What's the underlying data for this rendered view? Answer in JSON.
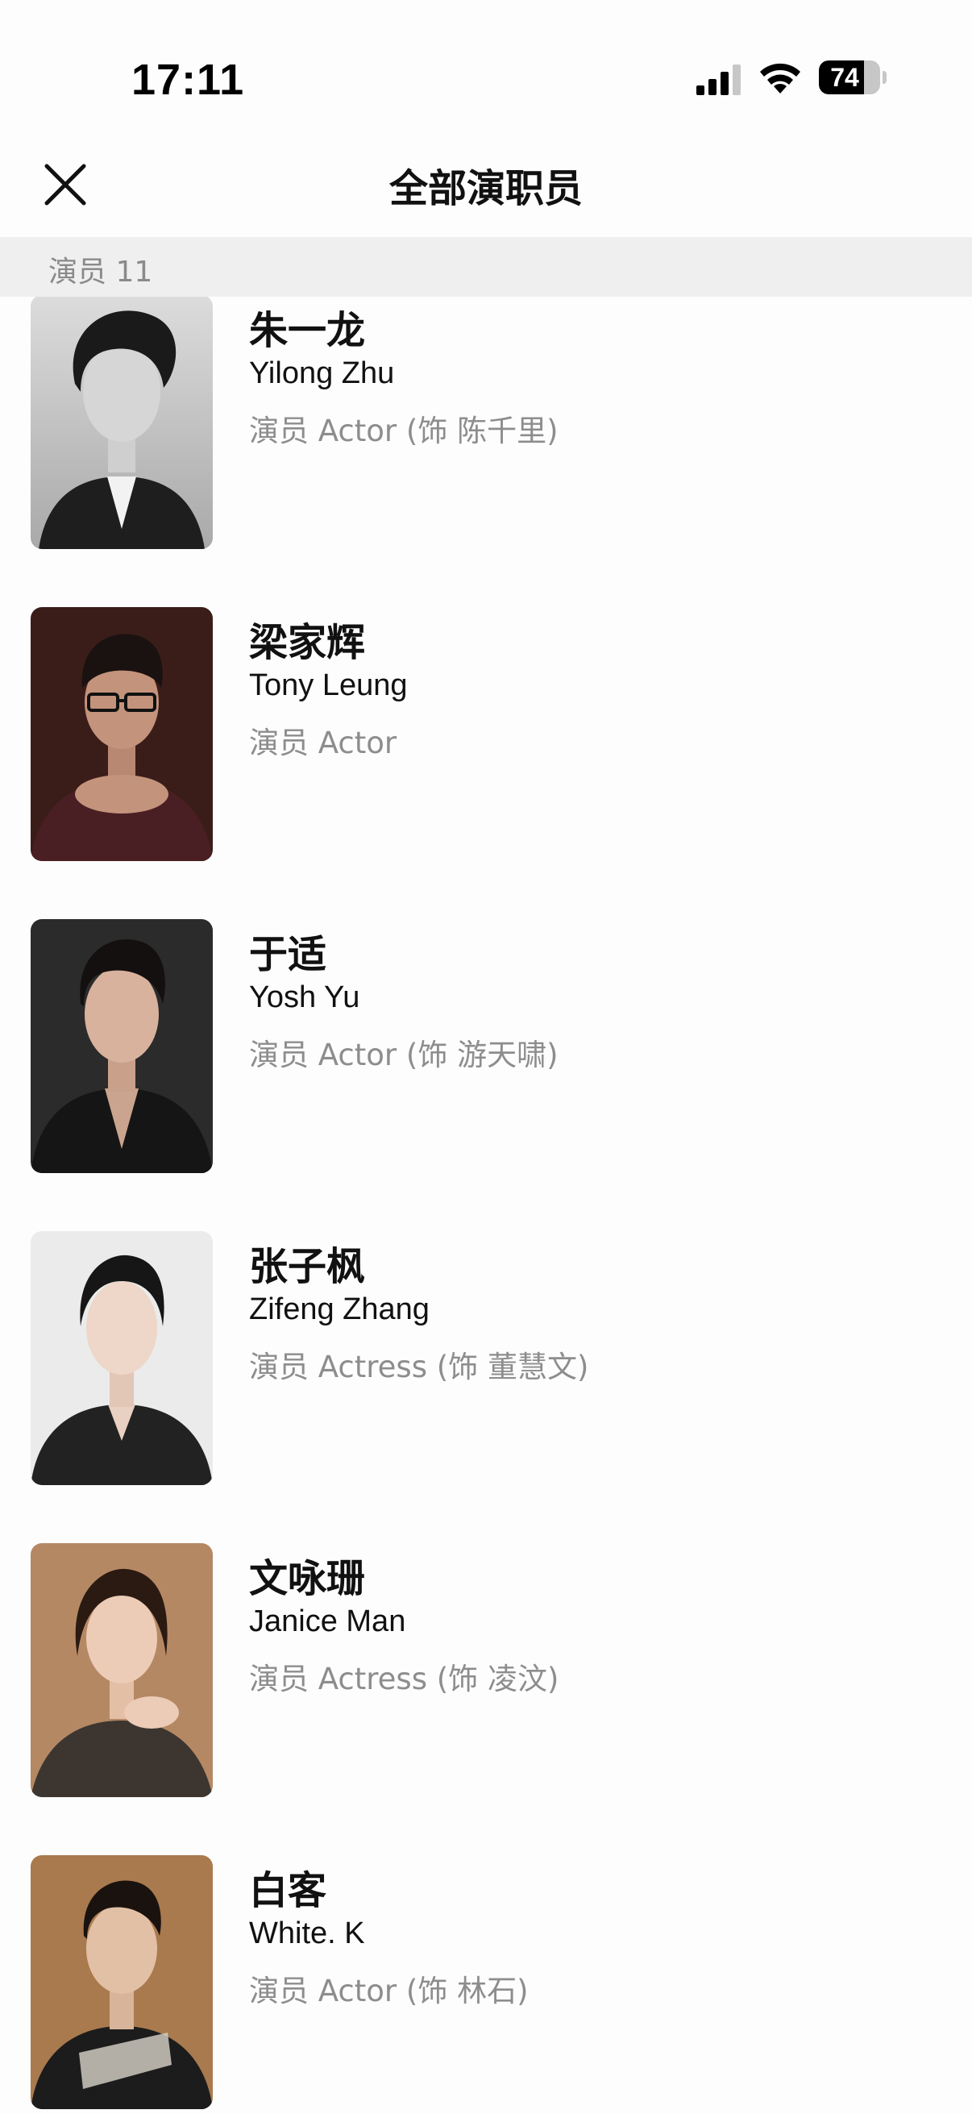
{
  "status_bar": {
    "time": "17:11",
    "battery": 74,
    "battery_label": "74",
    "icons": [
      "signal-icon",
      "wifi-icon",
      "battery-icon"
    ]
  },
  "header": {
    "title": "全部演职员",
    "close_icon": "close-icon"
  },
  "section": {
    "label": "演员 11"
  },
  "cast": [
    {
      "name_cn": "朱一龙",
      "name_en": "Yilong Zhu",
      "role": "演员 Actor (饰 陈千里)"
    },
    {
      "name_cn": "梁家辉",
      "name_en": "Tony Leung",
      "role": "演员 Actor"
    },
    {
      "name_cn": "于适",
      "name_en": "Yosh Yu",
      "role": "演员 Actor (饰 游天啸)"
    },
    {
      "name_cn": "张子枫",
      "name_en": "Zifeng Zhang",
      "role": "演员 Actress (饰 董慧文)"
    },
    {
      "name_cn": "文咏珊",
      "name_en": "Janice Man",
      "role": "演员 Actress (饰 凌汶)"
    },
    {
      "name_cn": "白客",
      "name_en": "White. K",
      "role": "演员 Actor (饰 林石)"
    }
  ]
}
